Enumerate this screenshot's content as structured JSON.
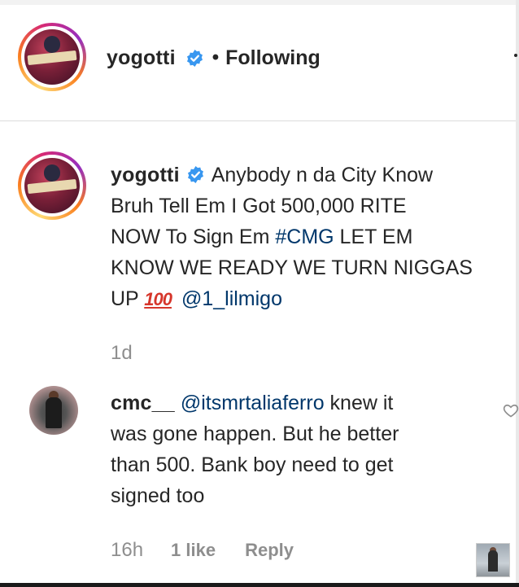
{
  "header": {
    "username": "yogotti",
    "separator": "•",
    "follow_status": "Following"
  },
  "caption": {
    "username": "yogotti",
    "text_line1": "Anybody n da City Know",
    "text_line2": "Bruh Tell Em I Got 500,000 RITE",
    "text_line3a": "NOW To Sign Em ",
    "hashtag": "#CMG",
    "text_line3b": " LET EM",
    "text_line4": "KNOW WE READY WE TURN NIGGAS",
    "text_line5": "UP ",
    "emoji": "100",
    "mention": "@1_lilmigo",
    "timestamp": "1d"
  },
  "comment": {
    "username": "cmc__",
    "mention": "@itsmrtaliaferro",
    "text_line1": " knew it",
    "text_line2": "was gone happen. But he better",
    "text_line3": "than 500. Bank boy need to get",
    "text_line4": "signed too",
    "age": "16h",
    "likes": "1 like",
    "reply_label": "Reply"
  },
  "colors": {
    "text": "#262626",
    "muted": "#8e8e8e",
    "link": "#00376b",
    "verified": "#3897f0"
  }
}
